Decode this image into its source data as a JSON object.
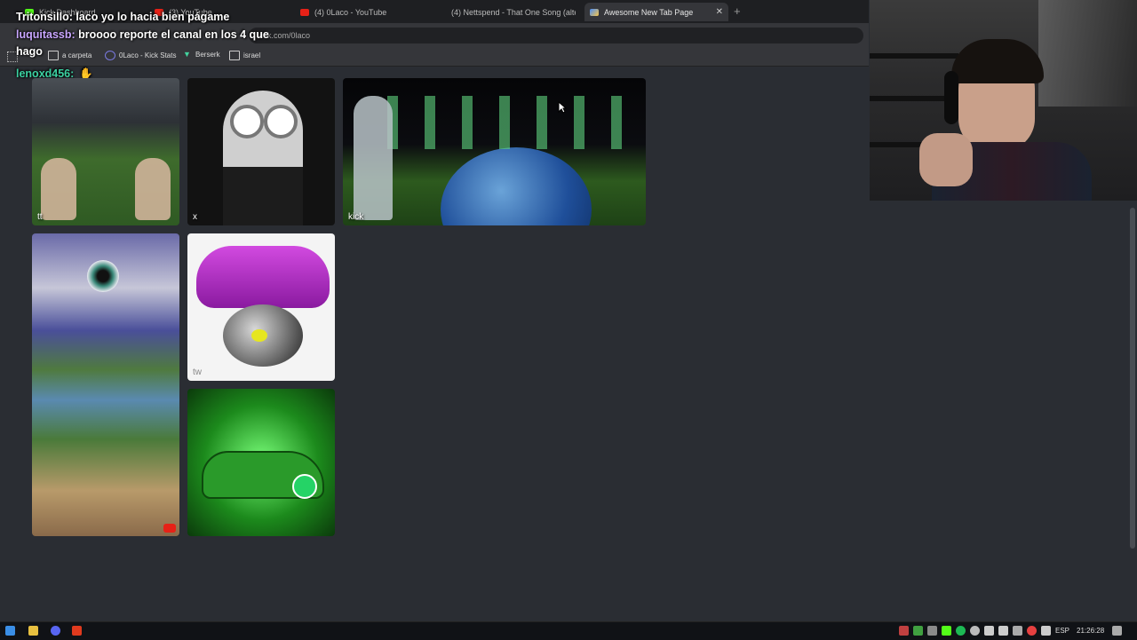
{
  "browser": {
    "tabs": [
      {
        "label": "Kick Dashboard",
        "active": false
      },
      {
        "label": "(3) YouTube",
        "active": false
      },
      {
        "label": "(4) 0Laco - YouTube",
        "active": false
      },
      {
        "label": "(4) Nettspend - That One Song (alte",
        "active": false
      },
      {
        "label": "Awesome New Tab Page",
        "active": true
      }
    ],
    "new_tab_symbol": "+",
    "close_symbol": "✕",
    "url": "kick.com/0laco",
    "bookmarks": [
      {
        "label": "a carpeta",
        "icon": "folder-icon"
      },
      {
        "label": "0Laco - Kick Stats",
        "icon": "chart-icon"
      },
      {
        "label": "Berserk",
        "icon": "berserk-icon"
      },
      {
        "label": "israel",
        "icon": "folder-icon"
      }
    ]
  },
  "chat": [
    {
      "user": "Tritonsillo:",
      "message": " laco yo lo hacia bien págame",
      "user_color": "#ffffff"
    },
    {
      "user": "luquitassb:",
      "message": " broooo reporte el canal en los 4 que",
      "user_color": "#c9a6ff"
    },
    {
      "user": "",
      "message": "hago",
      "user_color": "#ffffff"
    },
    {
      "user": "lenoxd456:",
      "message": "",
      "user_color": "#3bd1a1"
    }
  ],
  "tiles": [
    {
      "label": "tt"
    },
    {
      "label": "x"
    },
    {
      "label": "kick"
    },
    {
      "label": ""
    },
    {
      "label": "tw"
    },
    {
      "label": ""
    }
  ],
  "taskbar": {
    "language": "ESP",
    "time": "21:26:28"
  },
  "colors": {
    "page_bg": "#2a2d33",
    "accent_green": "#53fc18",
    "youtube_red": "#e62117"
  }
}
